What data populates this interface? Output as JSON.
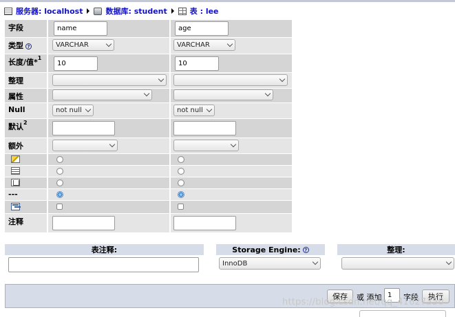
{
  "breadcrumb": {
    "server": "服务器: localhost",
    "database": "数据库: student",
    "table": "表 : lee"
  },
  "labels": {
    "field": "字段",
    "type": "类型",
    "length": "长度/值*",
    "length_sup": "1",
    "collation": "整理",
    "attributes": "属性",
    "null": "Null",
    "default": "默认",
    "default_sup": "2",
    "extra": "额外",
    "none_index": "---",
    "comment": "注释"
  },
  "columns": [
    {
      "name": "name",
      "type": "VARCHAR",
      "length": "10",
      "collation": "",
      "attributes": "",
      "null": "not null",
      "default": "",
      "extra": "",
      "comment": "",
      "index_selected": "none",
      "fulltext_checked": false
    },
    {
      "name": "age",
      "type": "VARCHAR",
      "length": "10",
      "collation": "",
      "attributes": "",
      "null": "not null",
      "default": "",
      "extra": "",
      "comment": "",
      "index_selected": "none",
      "fulltext_checked": false
    }
  ],
  "index_icons": [
    "primary-key-icon",
    "index-icon",
    "unique-icon",
    "fulltext-icon"
  ],
  "table_options": {
    "table_comment_label": "表注释:",
    "table_comment_value": "",
    "storage_engine_label": "Storage Engine:",
    "storage_engine_value": "InnoDB",
    "collation_label": "整理:",
    "collation_value": ""
  },
  "actions": {
    "save": "保存",
    "or_add": "或 添加",
    "add_count": "1",
    "fields_suffix": "字段",
    "go": "执行"
  },
  "watermark": "https://blog.csdn.net/qq_41627350",
  "colors": {
    "breadcrumb_link": "#1010c8",
    "row_dark": "#d5d5d5",
    "row_light": "#e5e5e5",
    "header_bar": "#d6dde8"
  }
}
